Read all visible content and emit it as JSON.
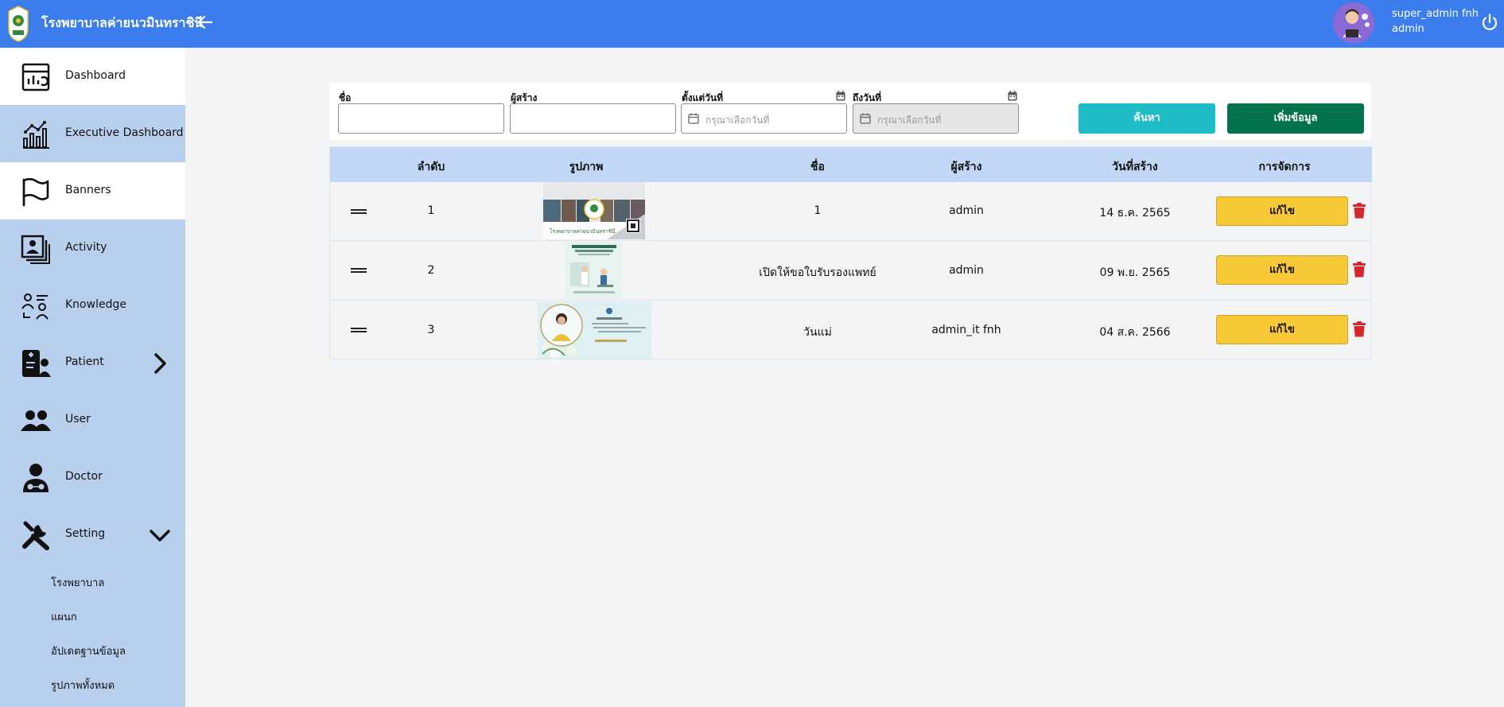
{
  "app": {
    "title": "โรงพยาบาลค่ายนวมินทราชินี",
    "user_name": "super_admin fnh",
    "user_role": "admin"
  },
  "sidebar": {
    "items": [
      {
        "label": "Dashboard",
        "icon": "dashboard-icon",
        "active": true
      },
      {
        "label": "Executive Dashboard",
        "icon": "chart-icon",
        "active": false
      },
      {
        "label": "Banners",
        "icon": "flag-icon",
        "active": true
      },
      {
        "label": "Activity",
        "icon": "activity-icon",
        "active": false
      },
      {
        "label": "Knowledge",
        "icon": "knowledge-icon",
        "active": false
      },
      {
        "label": "Patient",
        "icon": "patient-icon",
        "active": false
      },
      {
        "label": "User",
        "icon": "users-icon",
        "active": false
      },
      {
        "label": "Doctor",
        "icon": "doctor-icon",
        "active": false
      },
      {
        "label": "Setting",
        "icon": "setting-icon",
        "active": false
      }
    ],
    "setting_sub": [
      "โรงพยาบาล",
      "แผนก",
      "อัปเดตฐานข้อมูล",
      "รูปภาพทั้งหมด"
    ]
  },
  "filter": {
    "name_label": "ชื่อ",
    "creator_label": "ผู้สร้าง",
    "from_label": "ตั้งแต่วันที่",
    "to_label": "ถึงวันที่",
    "date_placeholder": "กรุณาเลือกวันที่",
    "search_label": "ค้นหา",
    "add_label": "เพิ่มข้อมูล"
  },
  "table": {
    "headers": {
      "order": "ลำดับ",
      "image": "รูปภาพ",
      "name": "ชื่อ",
      "creator": "ผู้สร้าง",
      "created": "วันที่สร้าง",
      "manage": "การจัดการ"
    },
    "edit_label": "แก้ไข",
    "rows": [
      {
        "order": "1",
        "name": "1",
        "creator": "admin",
        "created": "14 ธ.ค. 2565",
        "image_caption": "โรงพยาบาลค่ายนวมินทราชินี"
      },
      {
        "order": "2",
        "name": "เปิดให้ขอใบรับรองแพทย์",
        "creator": "admin",
        "created": "09 พ.ย. 2565"
      },
      {
        "order": "3",
        "name": "วันแม่",
        "creator": "admin_it fnh",
        "created": "04 ส.ค. 2566"
      }
    ]
  },
  "colors": {
    "topbar": "#3b7ded",
    "sidebar": "#b9cfee",
    "search_button": "#1fbcc7",
    "add_button": "#03734f",
    "edit_button": "#f7c936",
    "delete_icon": "#d9262b"
  }
}
